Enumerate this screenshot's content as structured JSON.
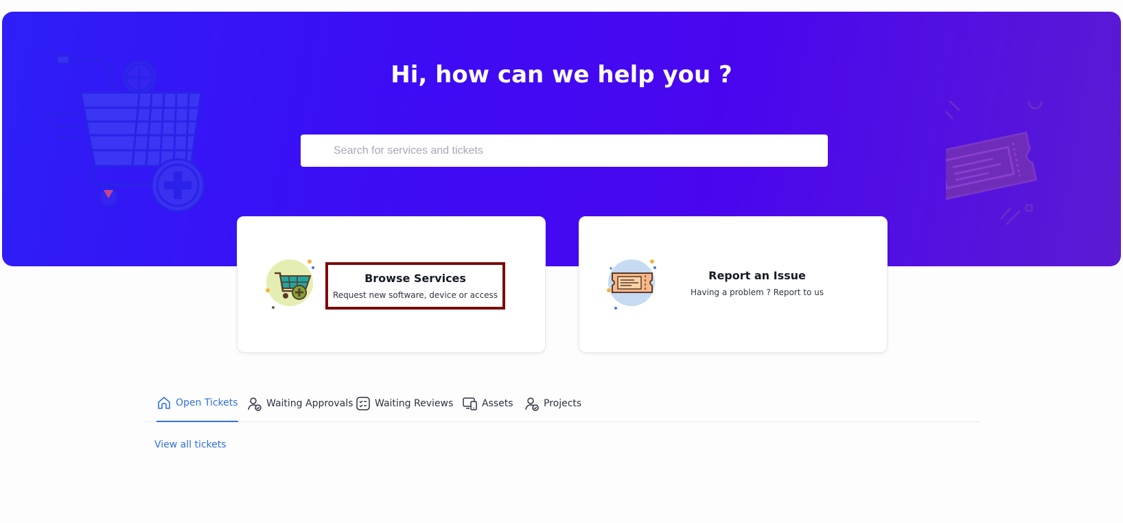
{
  "hero": {
    "title": "Hi, how can we help you ?",
    "search_placeholder": "Search for services and tickets"
  },
  "cards": [
    {
      "title": "Browse Services",
      "subtitle": "Request new software, device or access",
      "icon": "shopping-cart-icon",
      "highlighted": true
    },
    {
      "title": "Report an Issue",
      "subtitle": "Having a problem ? Report to us",
      "icon": "ticket-icon",
      "highlighted": false
    }
  ],
  "tabs": [
    {
      "label": "Open Tickets",
      "icon": "home-icon",
      "active": true
    },
    {
      "label": "Waiting Approvals",
      "icon": "user-check-icon",
      "active": false
    },
    {
      "label": "Waiting Reviews",
      "icon": "checklist-icon",
      "active": false
    },
    {
      "label": "Assets",
      "icon": "devices-icon",
      "active": false
    },
    {
      "label": "Projects",
      "icon": "user-check-icon",
      "active": false
    }
  ],
  "links": {
    "view_all": "View all tickets"
  },
  "colors": {
    "hero_gradient_start": "#2d1ff7",
    "hero_gradient_end": "#5a1bd3",
    "accent": "#2f6fdc",
    "highlight_border": "#7c0a0a"
  }
}
